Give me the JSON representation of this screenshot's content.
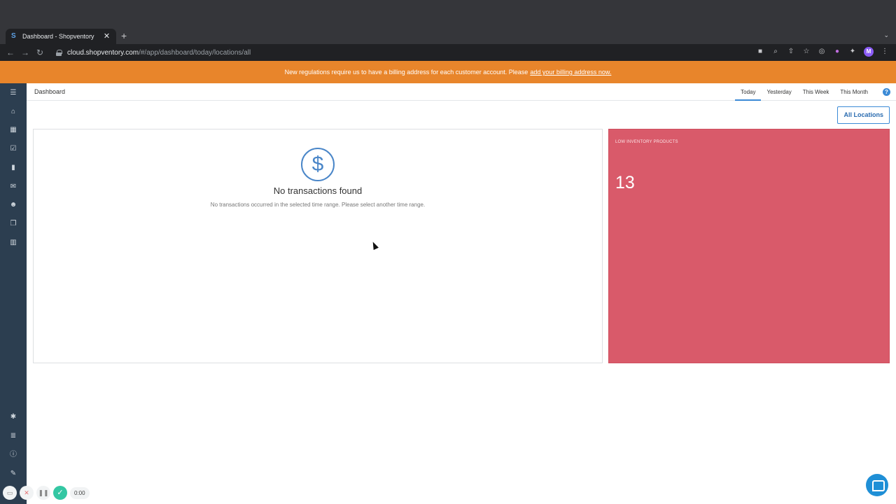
{
  "browser": {
    "tab_title": "Dashboard - Shopventory",
    "tab_favicon": "S",
    "tab_close": "✕",
    "new_tab": "+",
    "tab_menu": "⌄",
    "url_host": "cloud.shopventory.com",
    "url_path": "/#/app/dashboard/today/locations/all",
    "profile_initial": "M"
  },
  "banner": {
    "text": "New regulations require us to have a billing address for each customer account. Please",
    "link": "add your billing address now."
  },
  "header": {
    "title": "Dashboard",
    "tabs": [
      {
        "label": "Today",
        "active": true
      },
      {
        "label": "Yesterday",
        "active": false
      },
      {
        "label": "This Week",
        "active": false
      },
      {
        "label": "This Month",
        "active": false
      }
    ],
    "help": "?"
  },
  "locations_button": "All Locations",
  "transactions": {
    "icon": "$",
    "title": "No transactions found",
    "description": "No transactions occurred in the selected time range. Please select another time range."
  },
  "low_inventory": {
    "label": "LOW INVENTORY PRODUCTS",
    "count": "13"
  },
  "recorder": {
    "time": "0:00"
  },
  "colors": {
    "banner": "#e8852b",
    "sidebar": "#2c3e50",
    "accent": "#3b8ad6",
    "inventory_card": "#d95a6a"
  }
}
